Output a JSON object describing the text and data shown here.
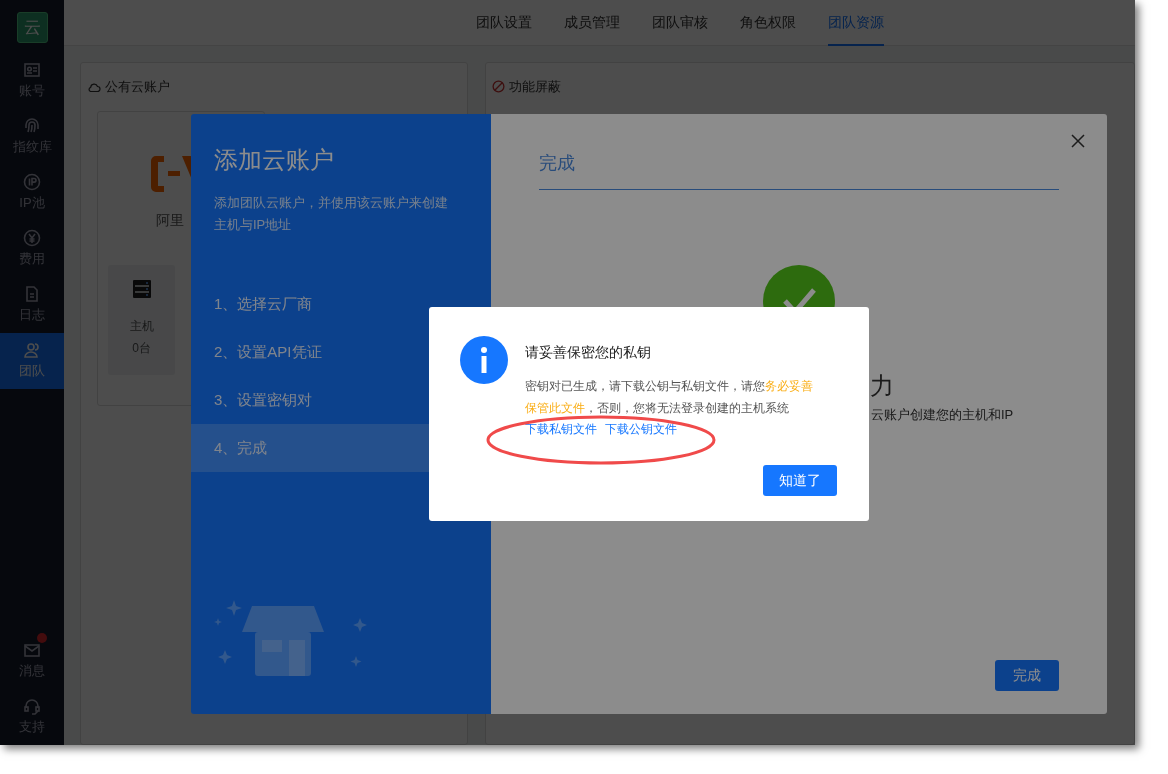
{
  "sidebar": {
    "logo": "云",
    "items": [
      {
        "label": "账号",
        "selected": false
      },
      {
        "label": "指纹库",
        "selected": false
      },
      {
        "label": "IP池",
        "selected": false
      },
      {
        "label": "费用",
        "selected": false
      },
      {
        "label": "日志",
        "selected": false
      },
      {
        "label": "团队",
        "selected": true
      }
    ],
    "bottom_items": [
      {
        "label": "消息",
        "badge": true
      },
      {
        "label": "支持",
        "badge": false
      }
    ]
  },
  "tabs": [
    {
      "label": "团队设置",
      "selected": false
    },
    {
      "label": "成员管理",
      "selected": false
    },
    {
      "label": "团队审核",
      "selected": false
    },
    {
      "label": "角色权限",
      "selected": false
    },
    {
      "label": "团队资源",
      "selected": true
    }
  ],
  "cloud_card": {
    "title": "公有云账户",
    "provider": {
      "name": "阿里",
      "stats": [
        {
          "label": "主机",
          "value": "0台"
        }
      ]
    }
  },
  "block_card": {
    "title": "功能屏蔽"
  },
  "wizard": {
    "title": "添加云账户",
    "description": "添加团队云账户，并使用该云账户来创建主机与IP地址",
    "steps": [
      {
        "label": "1、选择云厂商",
        "selected": false
      },
      {
        "label": "2、设置API凭证",
        "selected": false
      },
      {
        "label": "3、设置密钥对",
        "selected": false
      },
      {
        "label": "4、完成",
        "selected": true
      }
    ],
    "heading": "完成",
    "success_title": "力",
    "success_text": "云账户创建您的主机和IP",
    "done_button": "完成"
  },
  "alert": {
    "title": "请妥善保密您的私钥",
    "body": [
      {
        "text": "密钥对已生成，请下载公钥与私钥文件，请您",
        "emphasis": false
      },
      {
        "text": "务必妥善保管此文件",
        "emphasis": true
      },
      {
        "text": "，否则，您将无法登录创建的主机系统",
        "emphasis": false
      }
    ],
    "links": [
      "下载私钥文件",
      "下载公钥文件"
    ],
    "button": "知道了"
  }
}
